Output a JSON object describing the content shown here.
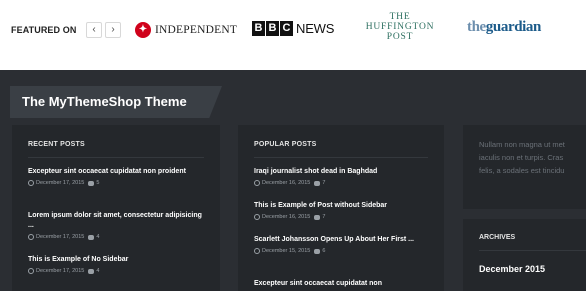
{
  "featured": {
    "label": "FEATURED ON",
    "prev": "‹",
    "next": "›",
    "logos": {
      "independent_eagle": "✦",
      "independent": "INDEPENDENT",
      "bbc_letters": [
        "B",
        "B",
        "C"
      ],
      "bbc_news": "NEWS",
      "huffington": [
        "THE",
        "HUFFINGTON",
        "POST"
      ],
      "guardian_the": "the",
      "guardian_name": "guardian"
    }
  },
  "banner": {
    "title": "The MyThemeShop Theme"
  },
  "recent": {
    "title": "RECENT POSTS",
    "posts": [
      {
        "title": "Excepteur sint occaecat cupidatat non proident",
        "date": "December 17, 2015",
        "comments": "5"
      },
      {
        "title": "Lorem ipsum dolor sit amet, consectetur adipisicing ...",
        "date": "December 17, 2015",
        "comments": "4"
      },
      {
        "title": "This is Example of No Sidebar",
        "date": "December 17, 2015",
        "comments": "4"
      }
    ]
  },
  "popular": {
    "title": "POPULAR POSTS",
    "posts": [
      {
        "title": "Iraqi journalist shot dead in Baghdad",
        "date": "December 16, 2015",
        "comments": "7"
      },
      {
        "title": "This is Example of Post without Sidebar",
        "date": "December 16, 2015",
        "comments": "7"
      },
      {
        "title": "Scarlett Johansson Opens Up About Her First ...",
        "date": "December 15, 2015",
        "comments": "6"
      },
      {
        "title": "Excepteur sint occaecat cupidatat non",
        "date": "",
        "comments": ""
      }
    ]
  },
  "text_widget": {
    "lines": [
      "Nullam non magna ut met",
      "iaculis non et turpis. Cras",
      "felis, a sodales est tincidu"
    ]
  },
  "archives": {
    "title": "ARCHIVES",
    "item": "December 2015"
  },
  "colors": {
    "accent_red": "#d0021b",
    "guardian_blue": "#1c5b8a",
    "huffington_green": "#2e7061"
  }
}
